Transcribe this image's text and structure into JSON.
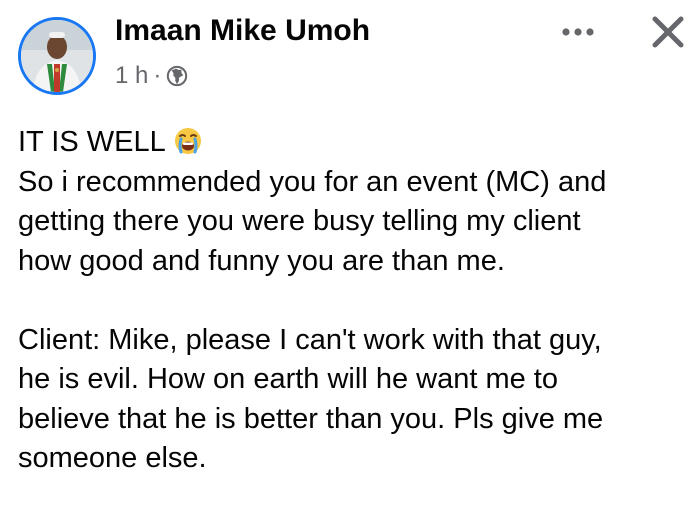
{
  "post": {
    "author": "Imaan Mike Umoh",
    "time": "1 h",
    "separator": "·",
    "privacy_icon": "globe-icon",
    "menu_icon": "more-options-icon",
    "close_icon": "close-icon",
    "headline": "IT IS WELL",
    "headline_emoji": "crying-face-emoji",
    "paragraph_1": [
      "So i recommended you for an event (MC) and",
      "getting there you were busy telling my client",
      "how good and funny you are than me."
    ],
    "paragraph_2": [
      "Client: Mike, please I can't work with that guy,",
      "he is evil. How on earth will he want me to",
      "believe that he is better than you. Pls give me",
      "someone else."
    ]
  },
  "colors": {
    "accent": "#1877f2",
    "text": "#050505",
    "meta": "#65676b",
    "icon": "#65676b"
  }
}
